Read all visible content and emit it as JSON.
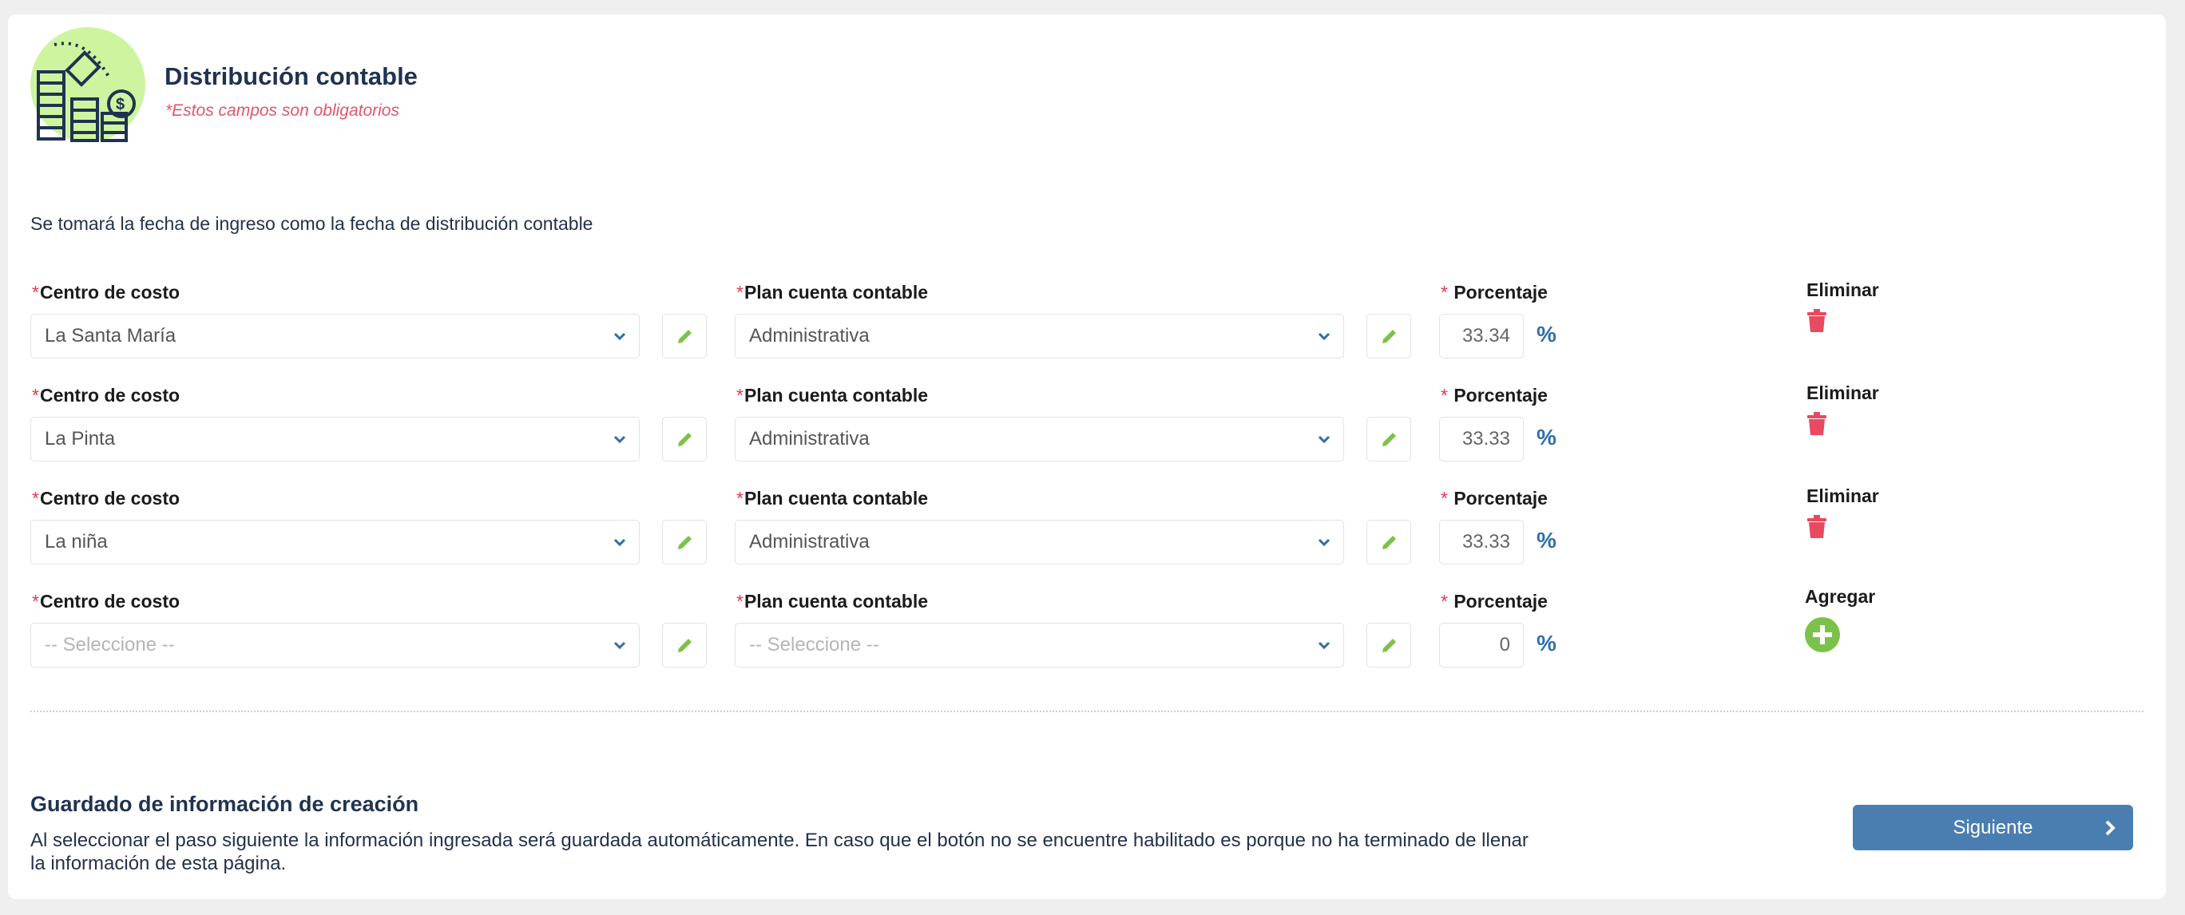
{
  "header": {
    "title": "Distribución contable",
    "required_note": "*Estos campos son obligatorios",
    "illustration_icon": "coins-accounting-illustration"
  },
  "intro": "Se tomará la fecha de ingreso como la fecha de distribución contable",
  "labels": {
    "required_mark": "*",
    "cost_center": "Centro de costo",
    "account_plan": "Plan cuenta contable",
    "percentage": "Porcentaje",
    "percent_sign": "%"
  },
  "rows": [
    {
      "cost_center": "La Santa María",
      "account_plan": "Administrativa",
      "percentage": "33.34",
      "action": "Eliminar"
    },
    {
      "cost_center": "La Pinta",
      "account_plan": "Administrativa",
      "percentage": "33.33",
      "action": "Eliminar"
    },
    {
      "cost_center": "La niña",
      "account_plan": "Administrativa",
      "percentage": "33.33",
      "action": "Eliminar"
    },
    {
      "cost_center": "-- Seleccione --",
      "account_plan": "-- Seleccione --",
      "percentage": "0",
      "action": "Agregar"
    }
  ],
  "footer": {
    "title": "Guardado de información de creación",
    "text": "Al seleccionar el paso siguiente la información ingresada será guardada automáticamente. En caso que el botón no se encuentre habilitado es porque no ha terminado de llenar la información de esta página.",
    "next_label": "Siguiente"
  },
  "colors": {
    "accent_blue": "#4a7eb0",
    "edit_green": "#7cc24a",
    "add_green": "#7cc24a",
    "delete_red": "#e84a5f",
    "required_red": "#e03b4e"
  }
}
